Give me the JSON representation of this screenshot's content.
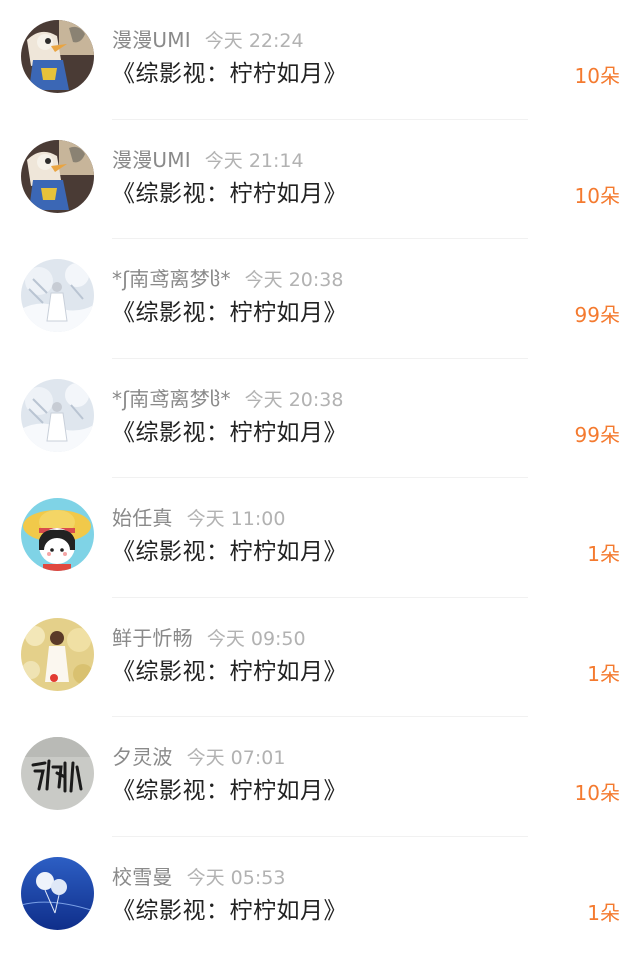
{
  "rows": [
    {
      "name": "漫漫UMI",
      "time": "今天 22:24",
      "title": "《综影视：柠柠如月》",
      "gift": "10朵",
      "avatar": "cartoon-duck-avatar"
    },
    {
      "name": "漫漫UMI",
      "time": "今天 21:14",
      "title": "《综影视：柠柠如月》",
      "gift": "10朵",
      "avatar": "cartoon-duck-avatar"
    },
    {
      "name": "*ʃ南鸢离梦ჱ*",
      "time": "今天 20:38",
      "title": "《综影视：柠柠如月》",
      "gift": "99朵",
      "avatar": "snowy-figure-avatar"
    },
    {
      "name": "*ʃ南鸢离梦ჱ*",
      "time": "今天 20:38",
      "title": "《综影视：柠柠如月》",
      "gift": "99朵",
      "avatar": "snowy-figure-avatar"
    },
    {
      "name": "始任真",
      "time": "今天 11:00",
      "title": "《综影视：柠柠如月》",
      "gift": "1朵",
      "avatar": "straw-hat-girl-avatar"
    },
    {
      "name": "鲜于忻畅",
      "time": "今天 09:50",
      "title": "《综影视：柠柠如月》",
      "gift": "1朵",
      "avatar": "bokeh-girl-avatar"
    },
    {
      "name": "夕灵波",
      "time": "今天 07:01",
      "title": "《综影视：柠柠如月》",
      "gift": "10朵",
      "avatar": "calligraphy-avatar"
    },
    {
      "name": "校雪曼",
      "time": "今天 05:53",
      "title": "《综影视：柠柠如月》",
      "gift": "1朵",
      "avatar": "balloon-sky-avatar"
    }
  ],
  "colors": {
    "name": "#8a8a8a",
    "time": "#b2b2b2",
    "title": "#222222",
    "gift": "#f47a2f",
    "divider": "#f1f1f1"
  }
}
